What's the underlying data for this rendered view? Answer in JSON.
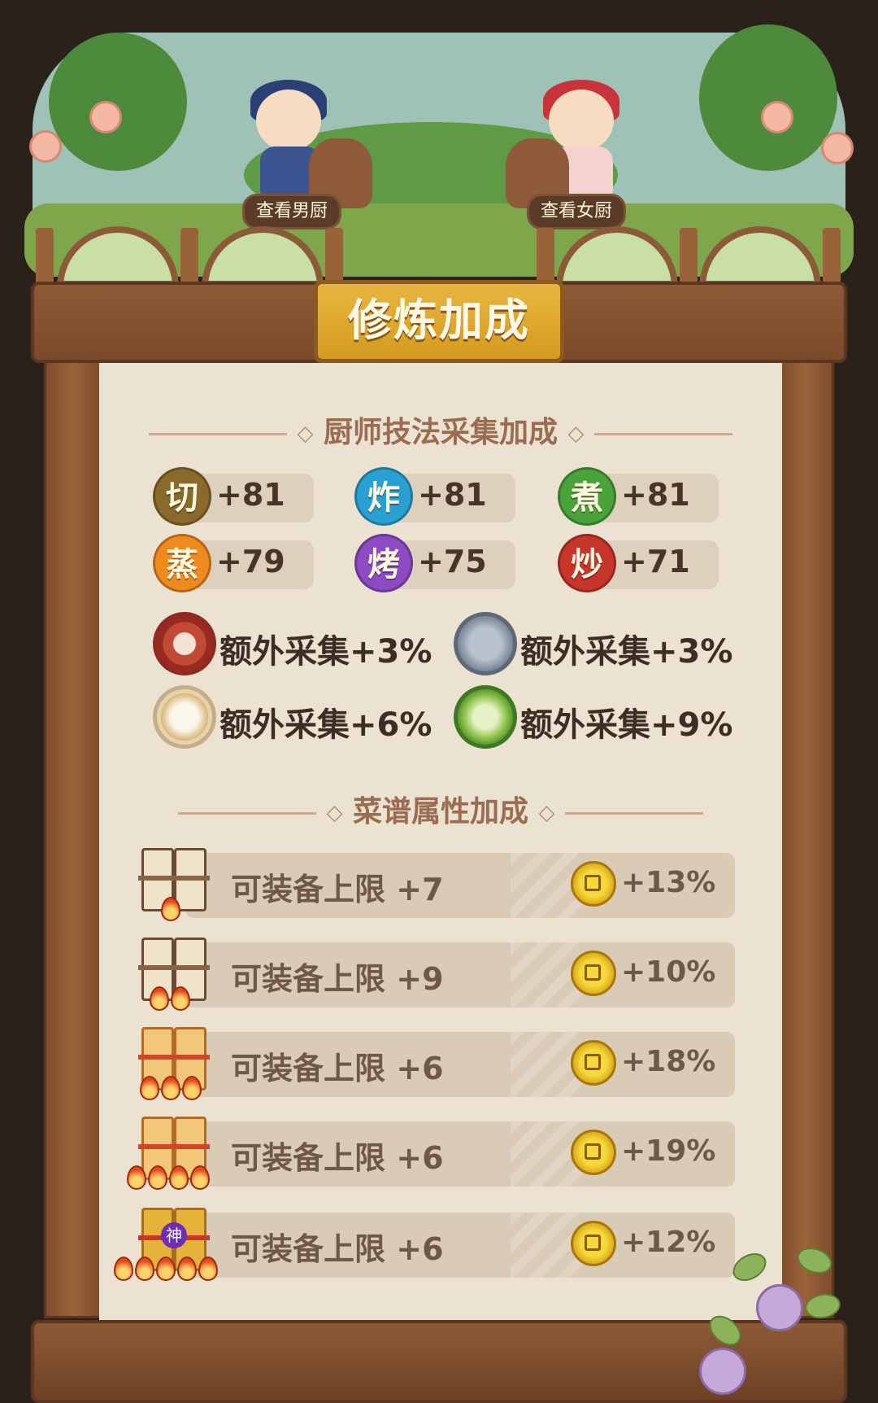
{
  "header": {
    "male_chef_label": "查看男厨",
    "female_chef_label": "查看女厨"
  },
  "panel": {
    "title": "修炼加成"
  },
  "skill_section": {
    "title": "厨师技法采集加成",
    "skills": [
      {
        "glyph": "切",
        "value": "+81",
        "color": "#8a6a2a"
      },
      {
        "glyph": "炸",
        "value": "+81",
        "color": "#2aa0d2"
      },
      {
        "glyph": "煮",
        "value": "+81",
        "color": "#4aa33a"
      },
      {
        "glyph": "蒸",
        "value": "+79",
        "color": "#ef8a1f"
      },
      {
        "glyph": "烤",
        "value": "+75",
        "color": "#8c4bc2"
      },
      {
        "glyph": "炒",
        "value": "+71",
        "color": "#c8352a"
      }
    ],
    "gather_bonuses": [
      {
        "icon": "meat-icon",
        "text": "额外采集+3%"
      },
      {
        "icon": "fish-icon",
        "text": "额外采集+3%"
      },
      {
        "icon": "flour-icon",
        "text": "额外采集+6%"
      },
      {
        "icon": "cabbage-icon",
        "text": "额外采集+9%"
      }
    ]
  },
  "recipe_section": {
    "title": "菜谱属性加成",
    "rows": [
      {
        "label": "可装备上限 +7",
        "coin_bonus": "+13%",
        "flames": 1
      },
      {
        "label": "可装备上限 +9",
        "coin_bonus": "+10%",
        "flames": 2
      },
      {
        "label": "可装备上限 +6",
        "coin_bonus": "+18%",
        "flames": 3
      },
      {
        "label": "可装备上限 +6",
        "coin_bonus": "+19%",
        "flames": 4
      },
      {
        "label": "可装备上限 +6",
        "coin_bonus": "+12%",
        "flames": 5,
        "badge": "神"
      }
    ]
  }
}
